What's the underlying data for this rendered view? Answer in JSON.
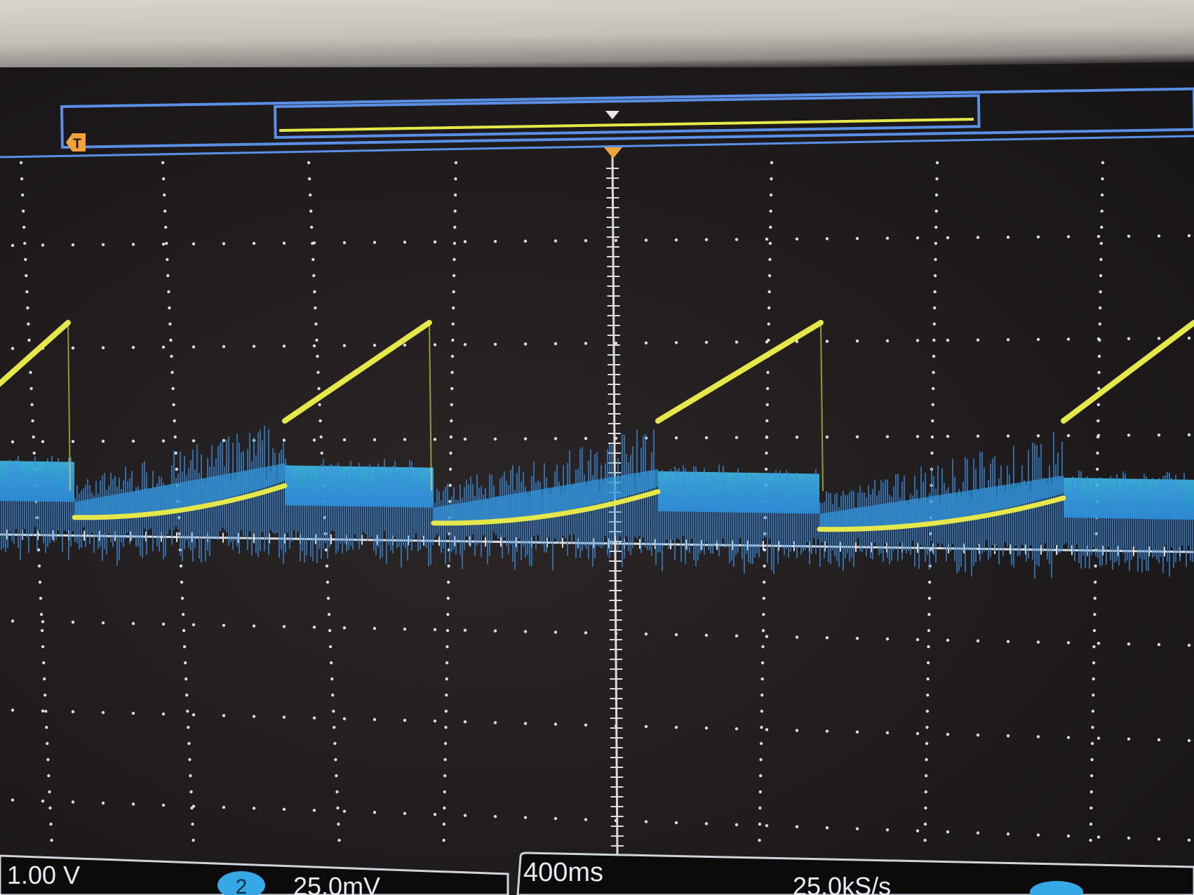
{
  "trigger": {
    "marker_letter": "T"
  },
  "status_bar": {
    "ch1_scale": "1.00 V",
    "ch2_badge": "2",
    "ch2_scale": "25.0mV",
    "timebase": "400ms",
    "sample_rate": "25.0kS/s"
  },
  "colors": {
    "ch1_trace": "#e6e84a",
    "ch2_trace": "#3d8fe0",
    "ch2_band": "#2fb0e8",
    "grid": "#dcdcdc",
    "record_frame": "#5b8fe6",
    "trigger_marker": "#f2a23a",
    "screen_background": "#201c1d"
  },
  "icons": {
    "trigger_marker": "trigger-flag-icon",
    "trigger_position": "down-triangle-icon"
  }
}
